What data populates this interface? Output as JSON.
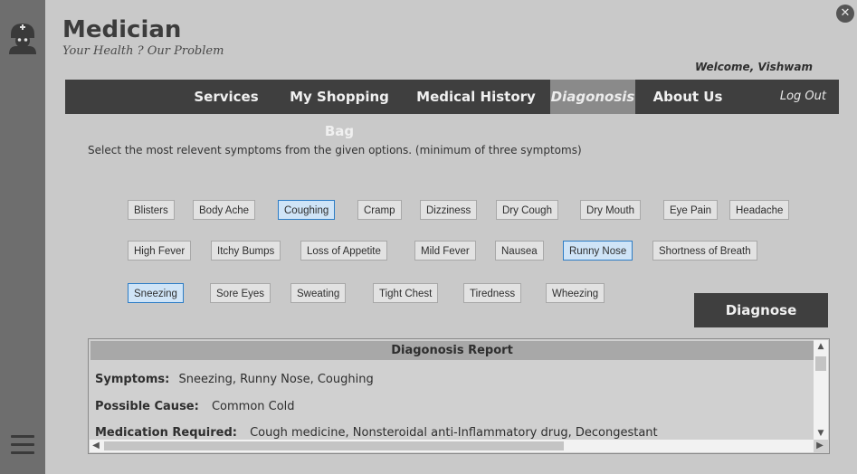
{
  "app": {
    "title": "Medician",
    "tagline": "Your Health ? Our Problem",
    "welcome": "Welcome, Vishwam"
  },
  "nav": {
    "items": [
      {
        "label": "Services",
        "active": false
      },
      {
        "label": "My Shopping Bag",
        "active": false
      },
      {
        "label": "Medical History",
        "active": false
      },
      {
        "label": "Diagonosis",
        "active": true
      },
      {
        "label": "About Us",
        "active": false
      }
    ],
    "logout": "Log Out"
  },
  "instructions": "Select the most relevent symptoms from the given options. (minimum of three symptoms)",
  "symptoms": [
    {
      "label": "Blisters",
      "selected": false
    },
    {
      "label": "Body Ache",
      "selected": false
    },
    {
      "label": "Coughing",
      "selected": true
    },
    {
      "label": "Cramp",
      "selected": false
    },
    {
      "label": "Dizziness",
      "selected": false
    },
    {
      "label": "Dry Cough",
      "selected": false
    },
    {
      "label": "Dry Mouth",
      "selected": false
    },
    {
      "label": "Eye Pain",
      "selected": false
    },
    {
      "label": "Headache",
      "selected": false
    },
    {
      "label": "High Fever",
      "selected": false
    },
    {
      "label": "Itchy Bumps",
      "selected": false
    },
    {
      "label": "Loss of Appetite",
      "selected": false
    },
    {
      "label": "Mild Fever",
      "selected": false
    },
    {
      "label": "Nausea",
      "selected": false
    },
    {
      "label": "Runny Nose",
      "selected": true
    },
    {
      "label": "Shortness of Breath",
      "selected": false
    },
    {
      "label": "Sneezing",
      "selected": true
    },
    {
      "label": "Sore Eyes",
      "selected": false
    },
    {
      "label": "Sweating",
      "selected": false
    },
    {
      "label": "Tight Chest",
      "selected": false
    },
    {
      "label": "Tiredness",
      "selected": false
    },
    {
      "label": "Wheezing",
      "selected": false
    }
  ],
  "diagnose_label": "Diagnose",
  "report": {
    "title": "Diagonosis Report",
    "symptoms_label": "Symptoms:",
    "symptoms_value": "Sneezing, Runny Nose, Coughing",
    "cause_label": "Possible Cause:",
    "cause_value": "Common Cold",
    "medication_label": "Medication Required:",
    "medication_value": "Cough medicine, Nonsteroidal anti-Inflammatory drug, Decongestant"
  },
  "colors": {
    "background": "#c9c9c9",
    "sidebar": "#6e6e6e",
    "navbar": "#3f3f3f",
    "nav_active": "#8a8a8a",
    "chip_selected_border": "#2d7dc6",
    "chip_selected_bg": "#cfe4f7"
  },
  "icons": {
    "app": "doctor-icon",
    "close": "close-icon",
    "menu": "hamburger-menu-icon"
  }
}
